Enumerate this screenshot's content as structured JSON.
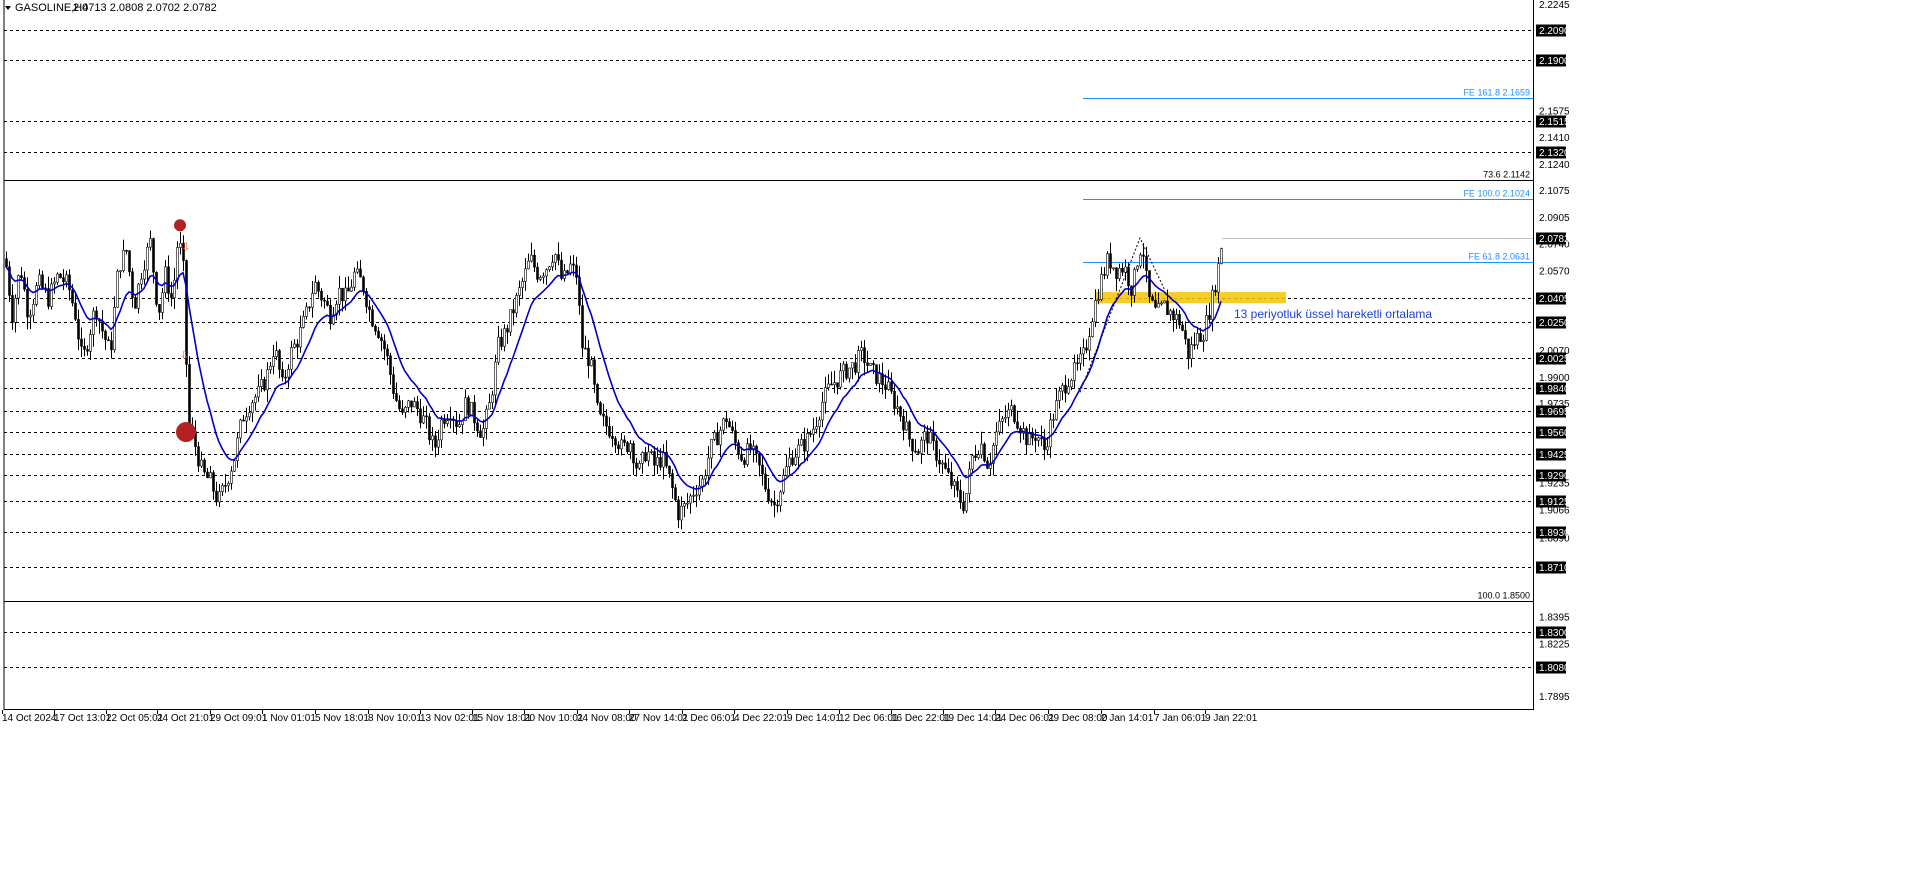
{
  "header": {
    "symbol": "GASOLINE,H4",
    "ohlc": "2.0713 2.0808 2.0702 2.0782"
  },
  "colors": {
    "background": "#ffffff",
    "candle": "#000000",
    "ema": "#0000cc",
    "fibo": "#1e90ff",
    "zone": "#f5c400",
    "marker": "#b22222",
    "arrow": "#e8501a"
  },
  "chart_data": {
    "type": "candlestick",
    "ylim": [
      1.785,
      2.2245
    ],
    "price_scale_labels": [
      "2.2245",
      "2.1575",
      "2.1410",
      "2.1240",
      "2.1075",
      "2.0905",
      "2.0740",
      "2.0570",
      "2.0070",
      "1.9900",
      "1.9735",
      "1.9235",
      "1.9066",
      "1.8890",
      "1.8395",
      "1.8225",
      "1.7895"
    ],
    "horizontal_levels": [
      {
        "label": "2.2090",
        "value": 2.209,
        "style": "dashed"
      },
      {
        "label": "2.1900",
        "value": 2.19,
        "style": "dashed"
      },
      {
        "label": "2.1515",
        "value": 2.1515,
        "style": "dashed"
      },
      {
        "label": "2.1320",
        "value": 2.132,
        "style": "dashed"
      },
      {
        "label": "2.0405",
        "value": 2.0405,
        "style": "dashed"
      },
      {
        "label": "2.0250",
        "value": 2.025,
        "style": "dashed"
      },
      {
        "label": "2.0025",
        "value": 2.0025,
        "style": "dashed"
      },
      {
        "label": "1.9840",
        "value": 1.984,
        "style": "dashed"
      },
      {
        "label": "1.9695",
        "value": 1.9695,
        "style": "dashed"
      },
      {
        "label": "1.9560",
        "value": 1.956,
        "style": "dashed"
      },
      {
        "label": "1.9425",
        "value": 1.9425,
        "style": "dashed"
      },
      {
        "label": "1.9290",
        "value": 1.929,
        "style": "dashed"
      },
      {
        "label": "1.9125",
        "value": 1.9125,
        "style": "dashed"
      },
      {
        "label": "1.8930",
        "value": 1.893,
        "style": "dashed"
      },
      {
        "label": "1.8710",
        "value": 1.871,
        "style": "dashed"
      },
      {
        "label": "1.8300",
        "value": 1.83,
        "style": "dashed"
      },
      {
        "label": "1.8080",
        "value": 1.808,
        "style": "dashed"
      }
    ],
    "current_price": {
      "label": "2.0782",
      "value": 2.0782
    },
    "fib_retracement": [
      {
        "label": "73.6 2.1142",
        "value": 2.1142
      },
      {
        "label": "100.0 1.8500",
        "value": 1.85
      }
    ],
    "fib_expansion": [
      {
        "label": "FE 161.8 2.1659",
        "value": 2.1659
      },
      {
        "label": "FE 100.0 2.1024",
        "value": 2.1024
      },
      {
        "label": "FE 61.8 2.0631",
        "value": 2.0631
      }
    ],
    "annotation": "13 periyotluk üssel hareketli ortalama",
    "x_labels": [
      "14 Oct 2024",
      "17 Oct 13:01",
      "22 Oct 05:01",
      "24 Oct 21:01",
      "29 Oct 09:01",
      "1 Nov 01:01",
      "5 Nov 18:01",
      "8 Nov 10:01",
      "13 Nov 02:01",
      "15 Nov 18:01",
      "20 Nov 10:01",
      "24 Nov 08:00",
      "27 Nov 14:01",
      "2 Dec 06:01",
      "4 Dec 22:01",
      "9 Dec 14:01",
      "12 Dec 06:01",
      "16 Dec 22:01",
      "19 Dec 14:01",
      "24 Dec 06:01",
      "29 Dec 08:00",
      "2 Jan 14:01",
      "7 Jan 06:01",
      "9 Jan 22:01"
    ],
    "price_path": [
      [
        0,
        2.112
      ],
      [
        5,
        2.065
      ],
      [
        12,
        2.03
      ],
      [
        20,
        2.06
      ],
      [
        28,
        2.03
      ],
      [
        38,
        2.05
      ],
      [
        48,
        2.04
      ],
      [
        58,
        2.055
      ],
      [
        68,
        2.048
      ],
      [
        75,
        2.03
      ],
      [
        82,
        2.0
      ],
      [
        88,
        2.015
      ],
      [
        95,
        2.035
      ],
      [
        102,
        2.02
      ],
      [
        110,
        2.005
      ],
      [
        118,
        2.06
      ],
      [
        126,
        2.07
      ],
      [
        134,
        2.035
      ],
      [
        142,
        2.06
      ],
      [
        150,
        2.075
      ],
      [
        158,
        2.03
      ],
      [
        165,
        2.055
      ],
      [
        172,
        2.038
      ],
      [
        178,
        2.08
      ],
      [
        183,
        2.058
      ],
      [
        188,
        1.96
      ],
      [
        194,
        1.95
      ],
      [
        202,
        1.93
      ],
      [
        210,
        1.925
      ],
      [
        218,
        1.912
      ],
      [
        226,
        1.925
      ],
      [
        234,
        1.94
      ],
      [
        242,
        1.965
      ],
      [
        250,
        1.975
      ],
      [
        258,
        1.98
      ],
      [
        266,
        1.99
      ],
      [
        274,
        2.01
      ],
      [
        282,
        1.985
      ],
      [
        290,
        2.005
      ],
      [
        298,
        2.015
      ],
      [
        306,
        2.03
      ],
      [
        314,
        2.05
      ],
      [
        322,
        2.04
      ],
      [
        330,
        2.03
      ],
      [
        338,
        2.045
      ],
      [
        346,
        2.04
      ],
      [
        354,
        2.055
      ],
      [
        362,
        2.05
      ],
      [
        370,
        2.03
      ],
      [
        378,
        2.02
      ],
      [
        386,
        2.005
      ],
      [
        394,
        1.98
      ],
      [
        402,
        1.965
      ],
      [
        410,
        1.975
      ],
      [
        418,
        1.97
      ],
      [
        426,
        1.96
      ],
      [
        434,
        1.945
      ],
      [
        442,
        1.965
      ],
      [
        450,
        1.97
      ],
      [
        458,
        1.96
      ],
      [
        466,
        1.975
      ],
      [
        474,
        1.965
      ],
      [
        482,
        1.955
      ],
      [
        490,
        1.975
      ],
      [
        498,
        2.01
      ],
      [
        506,
        2.02
      ],
      [
        514,
        2.035
      ],
      [
        522,
        2.05
      ],
      [
        530,
        2.065
      ],
      [
        538,
        2.055
      ],
      [
        546,
        2.06
      ],
      [
        554,
        2.07
      ],
      [
        562,
        2.05
      ],
      [
        570,
        2.06
      ],
      [
        576,
        2.055
      ],
      [
        582,
        2.01
      ],
      [
        590,
        2.0
      ],
      [
        598,
        1.965
      ],
      [
        606,
        1.96
      ],
      [
        614,
        1.955
      ],
      [
        622,
        1.945
      ],
      [
        630,
        1.95
      ],
      [
        638,
        1.93
      ],
      [
        646,
        1.945
      ],
      [
        654,
        1.935
      ],
      [
        662,
        1.94
      ],
      [
        670,
        1.925
      ],
      [
        678,
        1.905
      ],
      [
        686,
        1.91
      ],
      [
        694,
        1.92
      ],
      [
        702,
        1.925
      ],
      [
        710,
        1.945
      ],
      [
        718,
        1.955
      ],
      [
        726,
        1.965
      ],
      [
        734,
        1.95
      ],
      [
        742,
        1.94
      ],
      [
        750,
        1.945
      ],
      [
        758,
        1.935
      ],
      [
        766,
        1.92
      ],
      [
        774,
        1.91
      ],
      [
        782,
        1.925
      ],
      [
        790,
        1.94
      ],
      [
        798,
        1.945
      ],
      [
        806,
        1.95
      ],
      [
        814,
        1.96
      ],
      [
        822,
        1.975
      ],
      [
        830,
        1.985
      ],
      [
        838,
        1.99
      ],
      [
        846,
        1.995
      ],
      [
        854,
        1.998
      ],
      [
        862,
        2.005
      ],
      [
        870,
        1.995
      ],
      [
        878,
        1.99
      ],
      [
        886,
        1.985
      ],
      [
        894,
        1.975
      ],
      [
        902,
        1.965
      ],
      [
        910,
        1.95
      ],
      [
        918,
        1.945
      ],
      [
        926,
        1.955
      ],
      [
        934,
        1.945
      ],
      [
        942,
        1.935
      ],
      [
        950,
        1.925
      ],
      [
        958,
        1.915
      ],
      [
        964,
        1.91
      ],
      [
        972,
        1.94
      ],
      [
        980,
        1.95
      ],
      [
        988,
        1.935
      ],
      [
        996,
        1.955
      ],
      [
        1004,
        1.965
      ],
      [
        1012,
        1.97
      ],
      [
        1020,
        1.96
      ],
      [
        1028,
        1.95
      ],
      [
        1036,
        1.955
      ],
      [
        1044,
        1.945
      ],
      [
        1052,
        1.965
      ],
      [
        1060,
        1.98
      ],
      [
        1068,
        1.99
      ],
      [
        1076,
        1.995
      ],
      [
        1084,
        2.005
      ],
      [
        1092,
        2.03
      ],
      [
        1100,
        2.05
      ],
      [
        1108,
        2.065
      ],
      [
        1116,
        2.058
      ],
      [
        1124,
        2.06
      ],
      [
        1132,
        2.045
      ],
      [
        1138,
        2.068
      ],
      [
        1142,
        2.075
      ],
      [
        1148,
        2.04
      ],
      [
        1156,
        2.03
      ],
      [
        1164,
        2.035
      ],
      [
        1172,
        2.03
      ],
      [
        1180,
        2.025
      ],
      [
        1188,
        2.005
      ],
      [
        1196,
        2.015
      ],
      [
        1204,
        2.02
      ],
      [
        1212,
        2.04
      ],
      [
        1218,
        2.06
      ],
      [
        1222,
        2.0782
      ]
    ]
  }
}
